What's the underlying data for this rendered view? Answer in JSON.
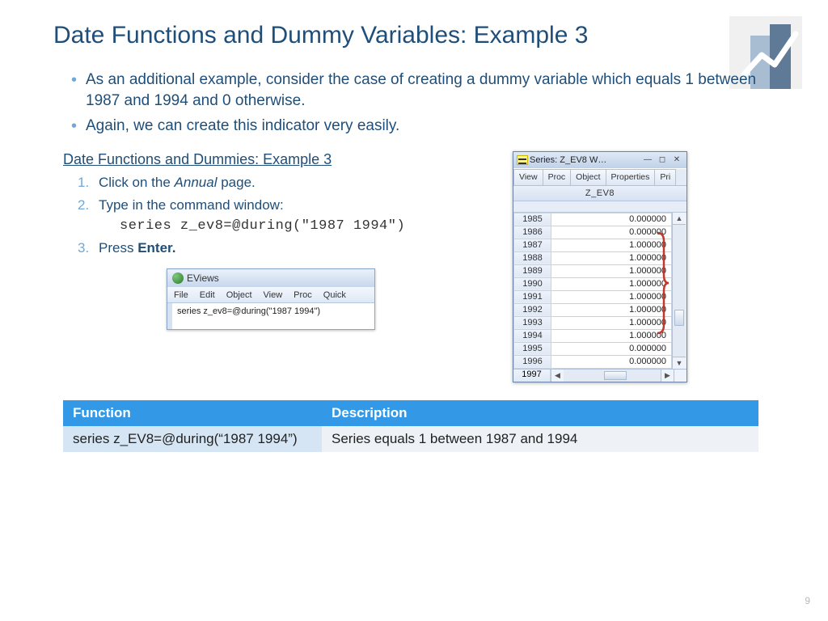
{
  "title": "Date Functions and Dummy Variables: Example 3",
  "bullets": [
    "As an additional example, consider the case of creating a dummy variable which equals 1 between 1987 and 1994 and 0 otherwise.",
    "Again, we can create this indicator very easily."
  ],
  "proc": {
    "title": "Date Functions and Dummies: Example 3",
    "step1_a": "Click on the ",
    "step1_i": "Annual",
    "step1_b": " page.",
    "step2": "Type in the command window:",
    "cmd": "series z_ev8=@during(\"1987 1994\")",
    "step3_a": "Press ",
    "step3_b": "Enter."
  },
  "ev_cmd": {
    "title": "EViews",
    "menu": [
      "File",
      "Edit",
      "Object",
      "View",
      "Proc",
      "Quick"
    ],
    "body": "series z_ev8=@during(\"1987 1994\")"
  },
  "ev_series": {
    "title": "Series: Z_EV8  W…",
    "tabs": [
      "View",
      "Proc",
      "Object",
      "Properties",
      "Pri"
    ],
    "name": "Z_EV8",
    "rows": [
      {
        "y": "1985",
        "v": "0.000000"
      },
      {
        "y": "1986",
        "v": "0.000000"
      },
      {
        "y": "1987",
        "v": "1.000000"
      },
      {
        "y": "1988",
        "v": "1.000000"
      },
      {
        "y": "1989",
        "v": "1.000000"
      },
      {
        "y": "1990",
        "v": "1.000000"
      },
      {
        "y": "1991",
        "v": "1.000000"
      },
      {
        "y": "1992",
        "v": "1.000000"
      },
      {
        "y": "1993",
        "v": "1.000000"
      },
      {
        "y": "1994",
        "v": "1.000000"
      },
      {
        "y": "1995",
        "v": "0.000000"
      },
      {
        "y": "1996",
        "v": "0.000000"
      }
    ],
    "last_year": "1997"
  },
  "ftable": {
    "h1": "Function",
    "h2": "Description",
    "fn": "series z_EV8=@during(“1987 1994”)",
    "ds": "Series equals 1 between 1987 and 1994"
  },
  "page": "9"
}
